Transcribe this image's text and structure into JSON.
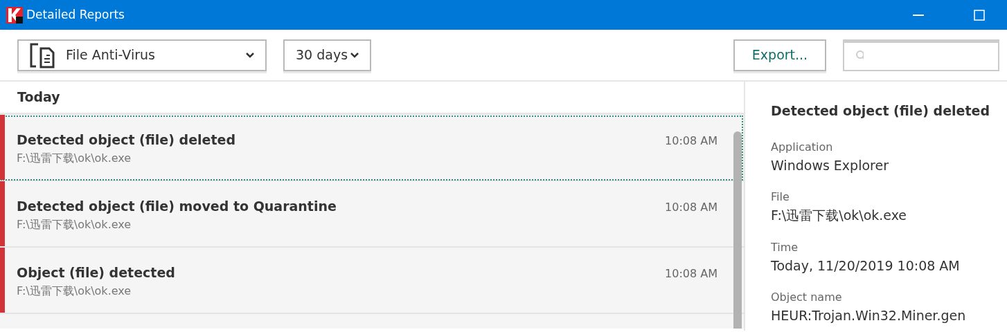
{
  "window": {
    "title": "Detailed Reports"
  },
  "toolbar": {
    "component": "File Anti-Virus",
    "period": "30 days",
    "export": "Export..."
  },
  "list": {
    "group": "Today",
    "events": [
      {
        "title": "Detected object (file) deleted",
        "path": "F:\\迅雷下载\\ok\\ok.exe",
        "time": "10:08 AM",
        "selected": true,
        "color": "#d13438"
      },
      {
        "title": "Detected object (file) moved to Quarantine",
        "path": "F:\\迅雷下载\\ok\\ok.exe",
        "time": "10:08 AM",
        "selected": false,
        "color": "#d13438"
      },
      {
        "title": "Object (file) detected",
        "path": "F:\\迅雷下载\\ok\\ok.exe",
        "time": "10:08 AM",
        "selected": false,
        "color": "#d13438"
      }
    ]
  },
  "details": {
    "title": "Detected object (file) deleted",
    "fields": [
      {
        "label": "Application",
        "value": "Windows Explorer"
      },
      {
        "label": "File",
        "value": "F:\\迅雷下载\\ok\\ok.exe"
      },
      {
        "label": "Time",
        "value": "Today, 11/20/2019 10:08 AM"
      },
      {
        "label": "Object name",
        "value": "HEUR:Trojan.Win32.Miner.gen"
      }
    ]
  }
}
